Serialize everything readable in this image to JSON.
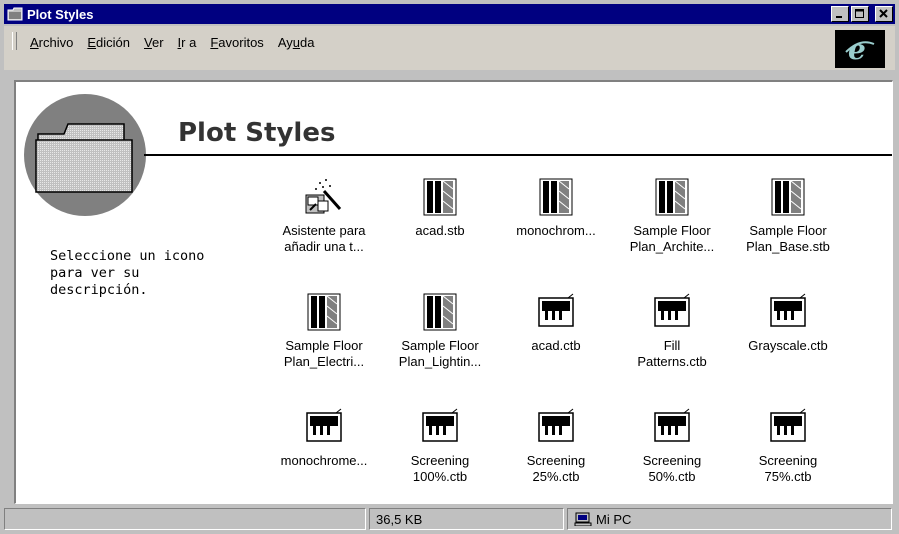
{
  "window": {
    "title": "Plot Styles"
  },
  "menu": {
    "items": [
      {
        "label": "Archivo",
        "underline": "A",
        "rest": "rchivo"
      },
      {
        "label": "Edición",
        "underline": "E",
        "rest": "dición"
      },
      {
        "label": "Ver",
        "underline": "V",
        "rest": "er"
      },
      {
        "label": "Ir a",
        "underline": "I",
        "rest": "r a"
      },
      {
        "label": "Favoritos",
        "underline": "F",
        "rest": "avoritos"
      },
      {
        "label": "Ayuda",
        "pre": "Ay",
        "underline": "u",
        "rest": "da"
      }
    ]
  },
  "folder": {
    "heading": "Plot Styles",
    "description": "Seleccione un icono para ver su descripción."
  },
  "files": [
    {
      "line1": "Asistente para",
      "line2": "añadir una t...",
      "icon": "wizard-icon"
    },
    {
      "line1": "acad.stb",
      "line2": "",
      "icon": "stb-icon"
    },
    {
      "line1": "monochrom...",
      "line2": "",
      "icon": "stb-icon"
    },
    {
      "line1": "Sample Floor",
      "line2": "Plan_Archite...",
      "icon": "stb-icon"
    },
    {
      "line1": "Sample Floor",
      "line2": "Plan_Base.stb",
      "icon": "stb-icon"
    },
    {
      "line1": "Sample Floor",
      "line2": "Plan_Electri...",
      "icon": "stb-icon"
    },
    {
      "line1": "Sample Floor",
      "line2": "Plan_Lightin...",
      "icon": "stb-icon"
    },
    {
      "line1": "acad.ctb",
      "line2": "",
      "icon": "ctb-icon"
    },
    {
      "line1": "Fill",
      "line2": "Patterns.ctb",
      "icon": "ctb-icon"
    },
    {
      "line1": "Grayscale.ctb",
      "line2": "",
      "icon": "ctb-icon"
    },
    {
      "line1": "monochrome...",
      "line2": "",
      "icon": "ctb-icon"
    },
    {
      "line1": "Screening",
      "line2": "100%.ctb",
      "icon": "ctb-icon"
    },
    {
      "line1": "Screening",
      "line2": "25%.ctb",
      "icon": "ctb-icon"
    },
    {
      "line1": "Screening",
      "line2": "50%.ctb",
      "icon": "ctb-icon"
    },
    {
      "line1": "Screening",
      "line2": "75%.ctb",
      "icon": "ctb-icon"
    }
  ],
  "status": {
    "size": "36,5 KB",
    "location": "Mi PC"
  },
  "colors": {
    "titlebar": "#000080",
    "face": "#c0c0c0",
    "content": "#ffffff"
  }
}
